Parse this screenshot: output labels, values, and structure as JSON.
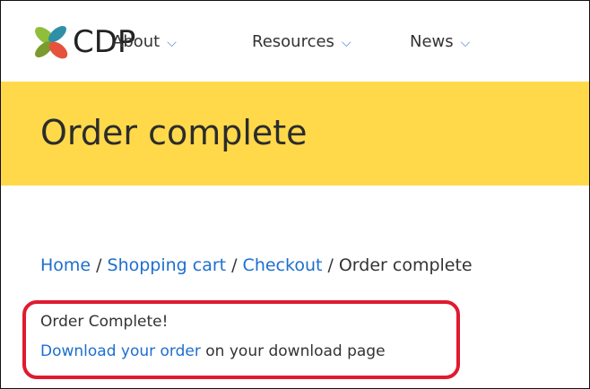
{
  "header": {
    "brand": "CDP",
    "nav": [
      {
        "label": "About",
        "icon": "chevron-down-icon"
      },
      {
        "label": "Resources",
        "icon": "chevron-down-icon"
      },
      {
        "label": "News",
        "icon": "chevron-down-icon"
      }
    ]
  },
  "hero": {
    "title": "Order complete"
  },
  "breadcrumb": {
    "items": [
      "Home",
      "Shopping cart",
      "Checkout",
      "Order complete"
    ],
    "separator": "/"
  },
  "message": {
    "status": "Order Complete!",
    "download_link": "Download your order",
    "download_suffix": "on your download page"
  },
  "colors": {
    "hero_bg": "#ffd94a",
    "link": "#1d6fcf",
    "highlight": "#e01a2f",
    "chevron": "#4a7fd7"
  }
}
